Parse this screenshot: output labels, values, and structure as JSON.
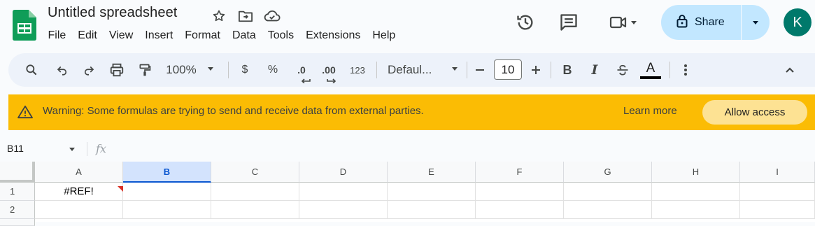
{
  "doc": {
    "title": "Untitled spreadsheet",
    "avatar_initial": "K"
  },
  "menu": [
    "File",
    "Edit",
    "View",
    "Insert",
    "Format",
    "Data",
    "Tools",
    "Extensions",
    "Help"
  ],
  "share": {
    "label": "Share"
  },
  "toolbar": {
    "zoom": "100%",
    "currency": "$",
    "percent": "%",
    "dec_decrease": ".0",
    "dec_increase": ".00",
    "number_format": "123",
    "font": "Defaul...",
    "font_size": "10",
    "bold": "B",
    "italic": "I",
    "text_color": "A"
  },
  "warning": {
    "message": "Warning: Some formulas are trying to send and receive data from external parties.",
    "learn_more": "Learn more",
    "allow": "Allow access"
  },
  "formula_bar": {
    "name_box": "B11",
    "fx": "fx",
    "value": ""
  },
  "grid": {
    "columns": [
      "A",
      "B",
      "C",
      "D",
      "E",
      "F",
      "G",
      "H",
      "I"
    ],
    "selected_column": "B",
    "rows": [
      "1",
      "2"
    ],
    "cells": {
      "A1": "#REF!"
    },
    "error_marker_color": "#d93025"
  },
  "colors": {
    "accent": "#0b57d0",
    "share_bg": "#c2e7ff",
    "warning_bg": "#fbbc04",
    "logo_green": "#0f9d58"
  }
}
